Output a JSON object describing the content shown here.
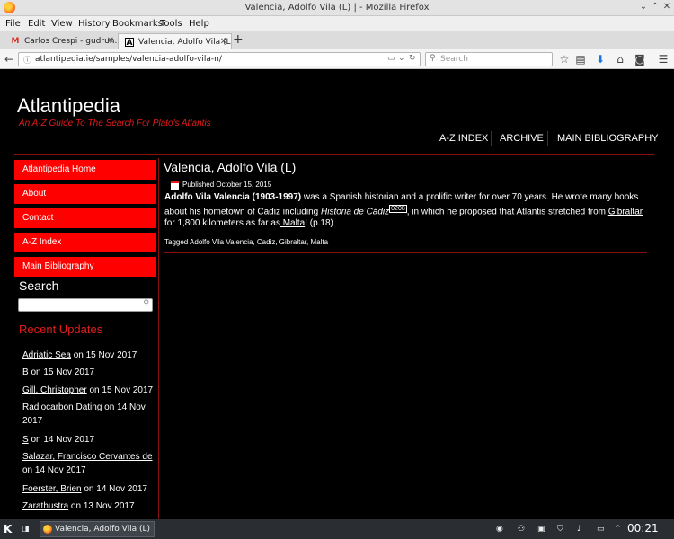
{
  "window": {
    "title": "Valencia, Adolfo Vila (L) | - Mozilla Firefox"
  },
  "menu": [
    "File",
    "Edit",
    "View",
    "History",
    "Bookmarks",
    "Tools",
    "Help"
  ],
  "tabs": [
    {
      "label": "Carlos Crespi - gudrun....",
      "icon": "M"
    },
    {
      "label": "Valencia, Adolfo Vila (L) |",
      "icon": "A"
    }
  ],
  "navbar": {
    "url": "atlantipedia.ie/samples/valencia-adolfo-vila-n/",
    "search_placeholder": "Search"
  },
  "site": {
    "title": "Atlantipedia",
    "tagline": "An A-Z Guide To The Search For Plato's Atlantis"
  },
  "topnav": [
    "A-Z INDEX",
    "ARCHIVE",
    "MAIN BIBLIOGRAPHY"
  ],
  "sidebar": {
    "buttons": [
      "Atlantipedia Home",
      "About",
      "Contact",
      "A-Z Index",
      "Main Bibliography"
    ],
    "search_heading": "Search",
    "recent_heading": "Recent Updates",
    "recent": [
      {
        "link": "Adriatic Sea",
        "date": " on 15 Nov 2017"
      },
      {
        "link": "B",
        "date": " on 15 Nov 2017"
      },
      {
        "link": "Gill, Christopher",
        "date": " on 15 Nov 2017"
      },
      {
        "link": "Radiocarbon Dating",
        "date": " on 14 Nov 2017"
      },
      {
        "link": "S",
        "date": " on 14 Nov 2017"
      },
      {
        "link": "Salazar, Francisco Cervantes de",
        "date": " on 14 Nov 2017"
      },
      {
        "link": "Foerster, Brien",
        "date": " on 14 Nov 2017"
      },
      {
        "link": "Zarathustra",
        "date": " on 13 Nov 2017"
      }
    ]
  },
  "post": {
    "title": "Valencia, Adolfo Vila (L)",
    "published": "Published October 15, 2015",
    "name_bold": "Adolfo Vila Valencia (1903-1997)",
    "text1": " was a Spanish historian and a prolific writer for over 70 years. He wrote many books about his hometown of Cadiz including ",
    "book": "Historia de Cádiz",
    "ref": "0208",
    "text2": ", in which he proposed that Atlantis stretched from ",
    "link1": "Gibraltar",
    "text3": " for 1,800 kilometers as far as",
    "link2": " Malta",
    "text4": "! (p.18)",
    "tags": "Tagged Adolfo Vila Valencia, Cadiz, Gibraltar, Malta"
  },
  "taskbar": {
    "window_label": "Valencia, Adolfo Vila (L) | - Mo",
    "clock": "00:21"
  }
}
